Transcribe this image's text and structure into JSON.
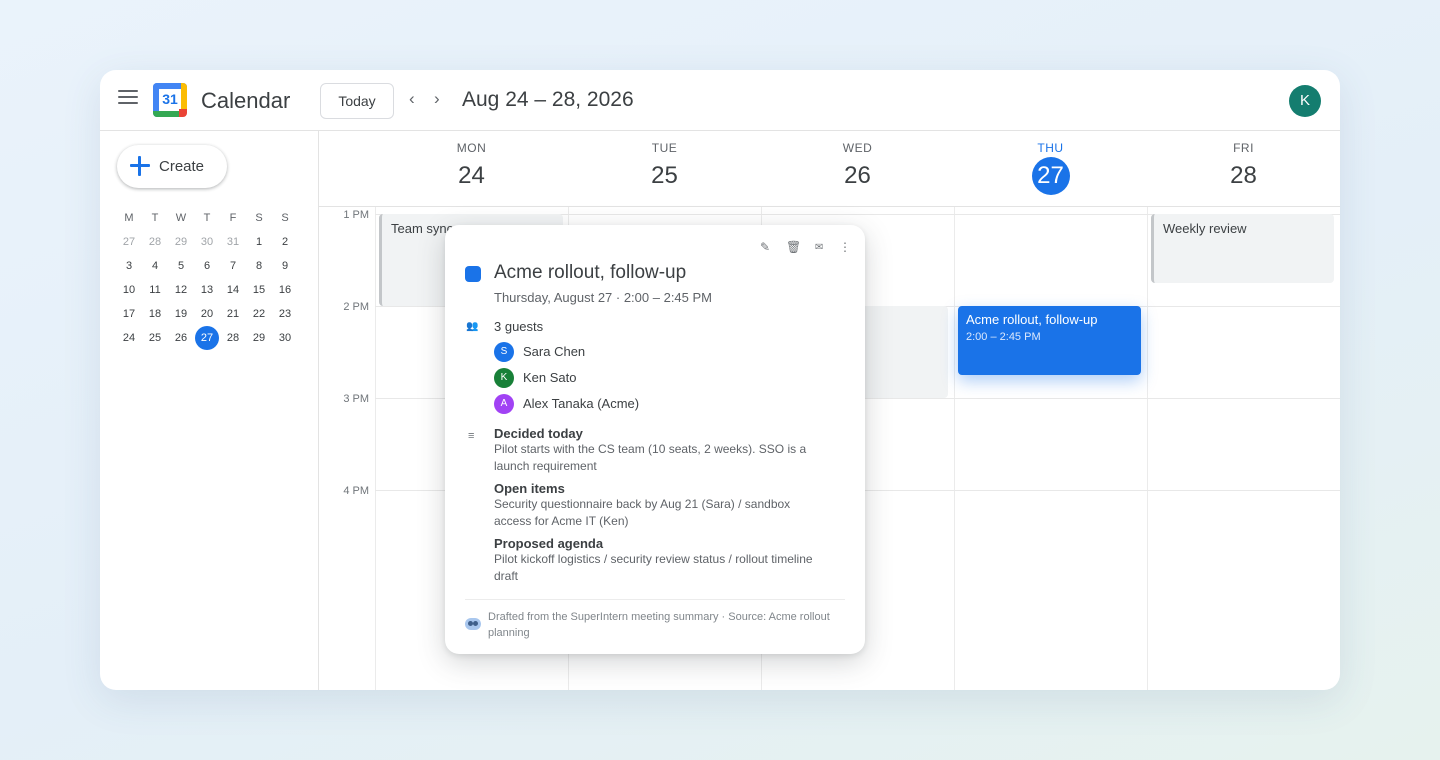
{
  "header": {
    "app_title": "Calendar",
    "logo_number": "31",
    "today_label": "Today",
    "prev_label": "‹",
    "next_label": "›",
    "date_range": "Aug 24 – 28, 2026",
    "avatar_initial": "K"
  },
  "sidebar": {
    "create_label": "Create",
    "mini_calendar": {
      "weekdays": [
        "M",
        "T",
        "W",
        "T",
        "F",
        "S",
        "S"
      ],
      "weeks": [
        [
          "27",
          "28",
          "29",
          "30",
          "31",
          "1",
          "2"
        ],
        [
          "3",
          "4",
          "5",
          "6",
          "7",
          "8",
          "9"
        ],
        [
          "10",
          "11",
          "12",
          "13",
          "14",
          "15",
          "16"
        ],
        [
          "17",
          "18",
          "19",
          "20",
          "21",
          "22",
          "23"
        ],
        [
          "24",
          "25",
          "26",
          "27",
          "28",
          "29",
          "30"
        ]
      ],
      "selected": "27"
    }
  },
  "week": {
    "days": [
      {
        "dow": "MON",
        "num": "24"
      },
      {
        "dow": "TUE",
        "num": "25"
      },
      {
        "dow": "WED",
        "num": "26"
      },
      {
        "dow": "THU",
        "num": "27"
      },
      {
        "dow": "FRI",
        "num": "28"
      }
    ],
    "today_index": 3,
    "times": [
      "1 PM",
      "2 PM",
      "3 PM",
      "4 PM"
    ]
  },
  "events": {
    "team_sync": {
      "title": "Team sync"
    },
    "weekly_review": {
      "title": "Weekly review"
    },
    "acme": {
      "title": "Acme rollout, follow-up",
      "time": "2:00 – 2:45 PM"
    }
  },
  "popover": {
    "title": "Acme rollout, follow-up",
    "when": "Thursday, August 27 · 2:00 – 2:45 PM",
    "icons": {
      "edit": "✎",
      "delete": "🗑",
      "email": "✉",
      "more": "⋮"
    },
    "guests_count": "3 guests",
    "guests": [
      {
        "initial": "S",
        "name": "Sara Chen",
        "color": "#1a73e8"
      },
      {
        "initial": "K",
        "name": "Ken Sato",
        "color": "#188038"
      },
      {
        "initial": "A",
        "name": "Alex Tanaka (Acme)",
        "color": "#a142f4"
      }
    ],
    "sections": [
      {
        "heading": "Decided today",
        "body": "Pilot starts with the CS team (10 seats, 2 weeks). SSO is a launch requirement"
      },
      {
        "heading": "Open items",
        "body": "Security questionnaire back by Aug 21 (Sara) / sandbox access for Acme IT (Ken)"
      },
      {
        "heading": "Proposed agenda",
        "body": "Pilot kickoff logistics / security review status / rollout timeline draft"
      }
    ],
    "source": "Drafted from the SuperIntern meeting summary · Source: Acme rollout planning"
  },
  "colors": {
    "accent": "#1a73e8",
    "avatar": "#147d6f"
  }
}
